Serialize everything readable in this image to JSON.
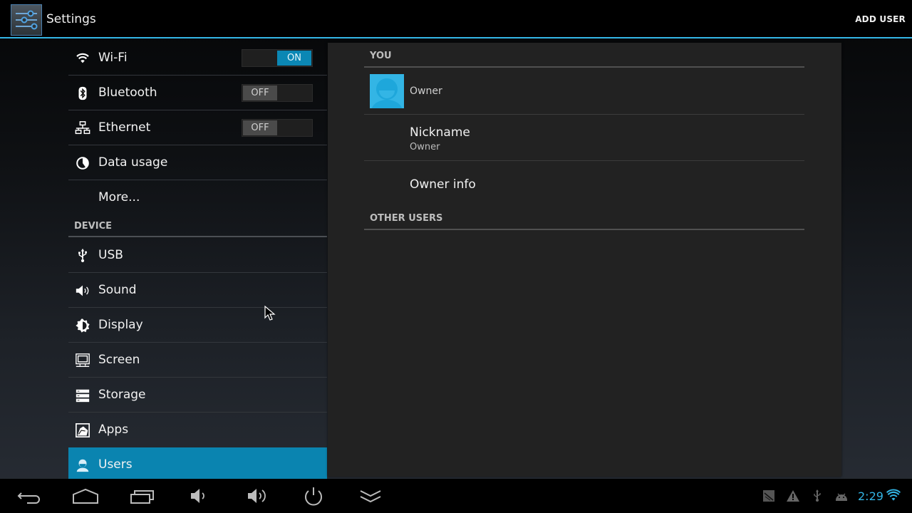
{
  "actionbar": {
    "app_icon": "settings-sliders-icon",
    "title": "Settings",
    "add_user_label": "ADD USER"
  },
  "left_list": {
    "wireless_items": [
      {
        "icon": "wifi-icon",
        "label": "Wi-Fi",
        "toggle": "ON"
      },
      {
        "icon": "bluetooth-icon",
        "label": "Bluetooth",
        "toggle": "OFF"
      },
      {
        "icon": "ethernet-icon",
        "label": "Ethernet",
        "toggle": "OFF"
      },
      {
        "icon": "data-usage-icon",
        "label": "Data usage"
      },
      {
        "label": "More..."
      }
    ],
    "device_header": "DEVICE",
    "device_items": [
      {
        "icon": "usb-icon",
        "label": "USB"
      },
      {
        "icon": "sound-icon",
        "label": "Sound"
      },
      {
        "icon": "display-icon",
        "label": "Display"
      },
      {
        "icon": "screen-icon",
        "label": "Screen"
      },
      {
        "icon": "storage-icon",
        "label": "Storage"
      },
      {
        "icon": "apps-icon",
        "label": "Apps"
      },
      {
        "icon": "users-icon",
        "label": "Users",
        "selected": true
      }
    ]
  },
  "right_panel": {
    "you_header": "YOU",
    "owner_name": "Owner",
    "nickname_title": "Nickname",
    "nickname_value": "Owner",
    "owner_info_title": "Owner info",
    "other_users_header": "OTHER USERS"
  },
  "navbar": {
    "buttons": [
      "back-icon",
      "home-icon",
      "recent-apps-icon",
      "volume-down-icon",
      "volume-up-icon",
      "power-icon",
      "collapse-icon"
    ],
    "status_icons": [
      "no-sdcard-icon",
      "warning-icon",
      "usb-debug-icon",
      "android-debug-icon",
      "wifi-signal-icon"
    ],
    "clock": "2:29"
  },
  "colors": {
    "accent": "#33b5e5",
    "selected_row": "#0a84b0",
    "toggle_on": "#0b87b4"
  }
}
